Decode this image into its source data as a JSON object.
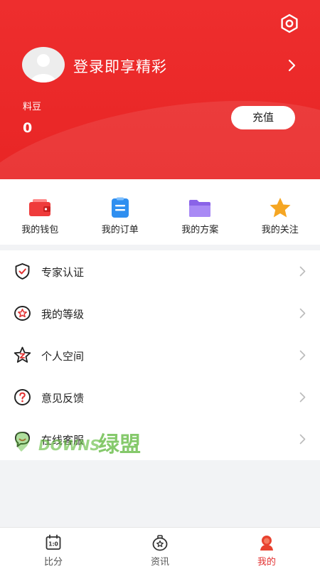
{
  "header": {
    "login_text": "登录即享精彩",
    "beans_label": "料豆",
    "beans_value": "0",
    "recharge_label": "充值"
  },
  "quick_actions": [
    {
      "label": "我的钱包",
      "icon": "wallet-icon"
    },
    {
      "label": "我的订单",
      "icon": "order-icon"
    },
    {
      "label": "我的方案",
      "icon": "folder-icon"
    },
    {
      "label": "我的关注",
      "icon": "star-icon"
    }
  ],
  "menu": [
    {
      "label": "专家认证",
      "icon": "shield-check-icon"
    },
    {
      "label": "我的等级",
      "icon": "level-badge-icon"
    },
    {
      "label": "个人空间",
      "icon": "star-z-icon"
    },
    {
      "label": "意见反馈",
      "icon": "question-icon"
    },
    {
      "label": "在线客服",
      "icon": "chat-icon"
    }
  ],
  "watermark": "DOWNS绿盟",
  "tabs": [
    {
      "label": "比分",
      "icon": "scoreboard-icon",
      "active": false
    },
    {
      "label": "资讯",
      "icon": "news-icon",
      "active": false
    },
    {
      "label": "我的",
      "icon": "profile-icon",
      "active": true
    }
  ],
  "colors": {
    "brand_red": "#e82525",
    "active_tab": "#e23030"
  }
}
